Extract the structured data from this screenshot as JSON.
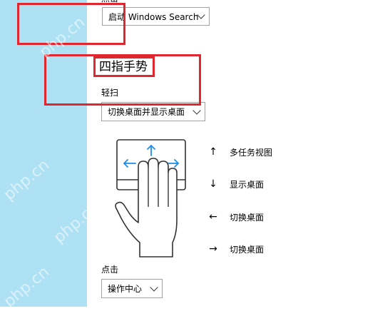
{
  "top_section": {
    "label": "点击",
    "dropdown_value": "启动 Windows Search"
  },
  "four_finger": {
    "heading": "四指手势",
    "swipe_label": "轻扫",
    "swipe_value": "切换桌面并显示桌面",
    "tap_label": "点击",
    "tap_value": "操作中心"
  },
  "gestures": [
    {
      "direction": "up",
      "arrow": "↑",
      "label": "多任务视图"
    },
    {
      "direction": "down",
      "arrow": "↓",
      "label": "显示桌面"
    },
    {
      "direction": "left",
      "arrow": "←",
      "label": "切换桌面"
    },
    {
      "direction": "right",
      "arrow": "→",
      "label": "切换桌面"
    }
  ],
  "watermark_text": "php.cn",
  "colors": {
    "sidebar": "#ade1f3",
    "highlight": "#e0262e",
    "gesture_arrow": "#1a8ee8"
  }
}
